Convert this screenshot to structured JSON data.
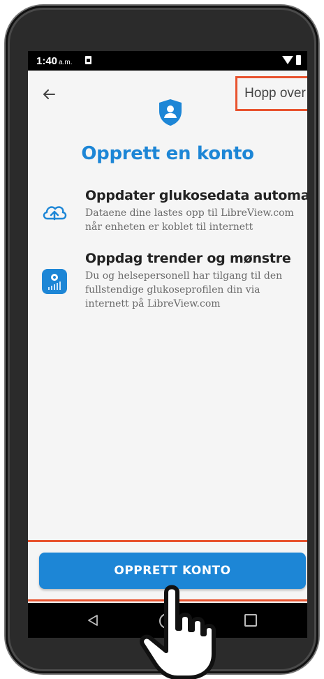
{
  "status_bar": {
    "time": "1:40",
    "ampm": "a.m."
  },
  "header": {
    "skip_label": "Hopp over"
  },
  "title": "Opprett en konto",
  "features": [
    {
      "icon": "cloud-upload-icon",
      "title": "Oppdater glukosedata automatisk",
      "description": "Dataene dine lastes opp til LibreView.com når enheten er koblet til internett"
    },
    {
      "icon": "libreview-app-icon",
      "title": "Oppdag trender og mønstre",
      "description": "Du og helsepersonell har tilgang til den fullstendige glukoseprofilen din via internett på LibreView.com"
    }
  ],
  "cta": {
    "label": "OPPRETT KONTO"
  },
  "colors": {
    "accent": "#1d86d6",
    "highlight": "#e8532f",
    "text": "#222222",
    "muted": "#6a6a6a"
  }
}
